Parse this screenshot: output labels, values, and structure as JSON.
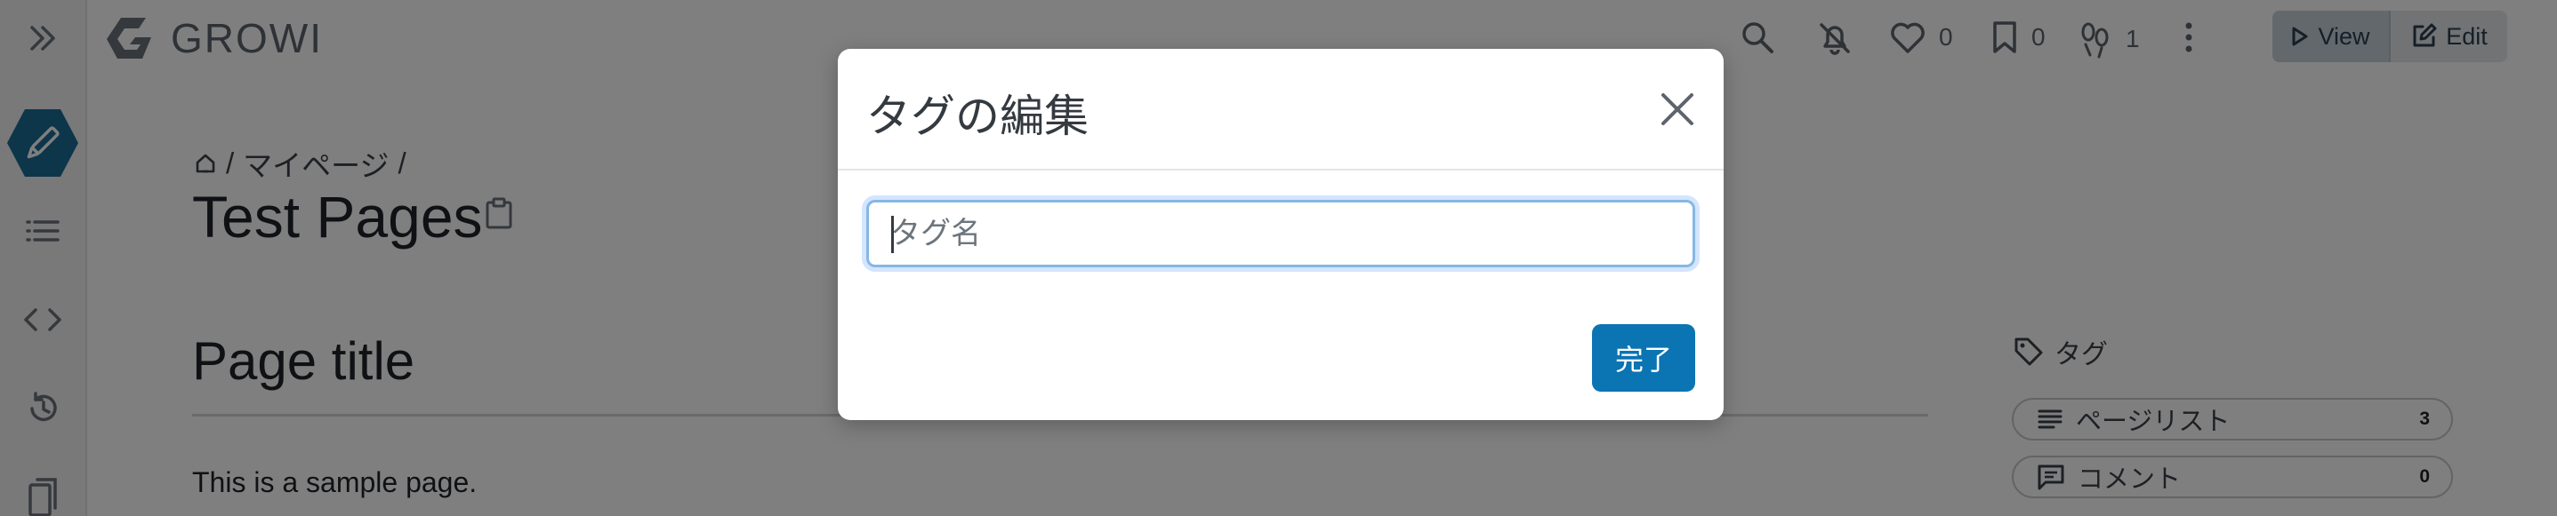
{
  "app": {
    "name": "GROWI"
  },
  "header": {
    "like_count": "0",
    "bookmark_count": "0",
    "seen_count": "1",
    "view_label": "View",
    "edit_label": "Edit"
  },
  "page": {
    "breadcrumb_item": "マイページ",
    "breadcrumb_sep": "/",
    "title": "Test Pages",
    "heading": "Page title",
    "body_text": "This is a sample page."
  },
  "right_panel": {
    "tag_label": "タグ",
    "items": [
      {
        "label": "ページリスト",
        "count": "3"
      },
      {
        "label": "コメント",
        "count": "0"
      }
    ]
  },
  "modal": {
    "title": "タグの編集",
    "input_placeholder": "タグ名",
    "input_value": "",
    "done_label": "完了"
  },
  "colors": {
    "accent": "#0b74b3",
    "sidebar_active": "#1a6d96"
  },
  "icons": {
    "sidebar": [
      "chevrons-right-icon",
      "pencil-icon",
      "list-icon",
      "code-icon",
      "history-icon",
      "bookmarks-icon"
    ],
    "header": [
      "growi-logo-icon",
      "search-icon",
      "bell-off-icon",
      "heart-icon",
      "bookmark-icon",
      "footprints-icon",
      "more-vertical-icon",
      "play-icon",
      "edit-icon"
    ]
  }
}
